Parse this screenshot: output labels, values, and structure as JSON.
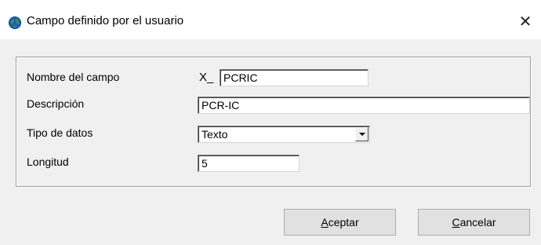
{
  "window": {
    "title": "Campo definido por el usuario",
    "icon": "globe-icon",
    "close_glyph": "✕"
  },
  "form": {
    "field_name": {
      "label": "Nombre del campo",
      "prefix": "X_",
      "value": "PCRIC"
    },
    "description": {
      "label": "Descripción",
      "value": "PCR-IC"
    },
    "data_type": {
      "label": "Tipo de datos",
      "value": "Texto"
    },
    "length": {
      "label": "Longitud",
      "value": "5"
    }
  },
  "buttons": {
    "accept": {
      "mnemonic": "A",
      "rest": "ceptar"
    },
    "cancel": {
      "mnemonic": "C",
      "rest": "ancelar"
    }
  },
  "colors": {
    "dialog_bg": "#f0f0f0",
    "titlebar_bg": "#ffffff",
    "button_bg": "#e1e1e1",
    "button_border": "#adadad"
  }
}
